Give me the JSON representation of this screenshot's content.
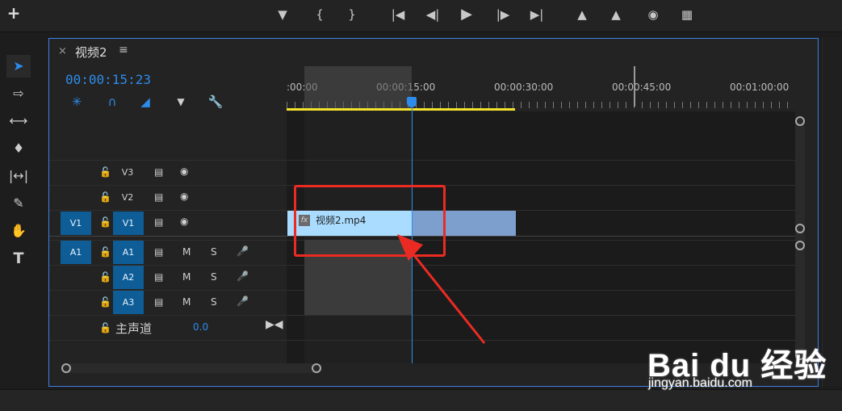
{
  "transport": {
    "icons": [
      "add-marker-icon",
      "mark-in-icon",
      "mark-out-icon",
      "go-to-in-icon",
      "step-back-icon",
      "play-icon",
      "step-forward-icon",
      "go-to-out-icon",
      "lift-icon",
      "extract-icon",
      "export-frame-icon",
      "compare-icon"
    ]
  },
  "sequence": {
    "tab_title": "视频2",
    "timecode": "00:00:15:23",
    "ruler_labels": [
      ":00:00",
      "00:00:15:00",
      "00:00:30:00",
      "00:00:45:00",
      "00:01:00:00"
    ]
  },
  "tracks": {
    "video": [
      {
        "source": "",
        "name": "V3"
      },
      {
        "source": "",
        "name": "V2"
      },
      {
        "source": "V1",
        "name": "V1"
      }
    ],
    "audio": [
      {
        "source": "A1",
        "name": "A1",
        "mute": "M",
        "solo": "S"
      },
      {
        "source": "",
        "name": "A2",
        "mute": "M",
        "solo": "S"
      },
      {
        "source": "",
        "name": "A3",
        "mute": "M",
        "solo": "S"
      }
    ],
    "master": {
      "label": "主声道",
      "value": "0.0"
    }
  },
  "clip": {
    "name": "视频2.mp4",
    "fx": "fx"
  },
  "watermark": {
    "logo": "Bai du 经验",
    "url": "jingyan.baidu.com"
  },
  "colors": {
    "accent": "#2d8ceb",
    "clip": "#a9dcff",
    "annotation": "#ea2b23",
    "work_area": "#f2e02a"
  }
}
